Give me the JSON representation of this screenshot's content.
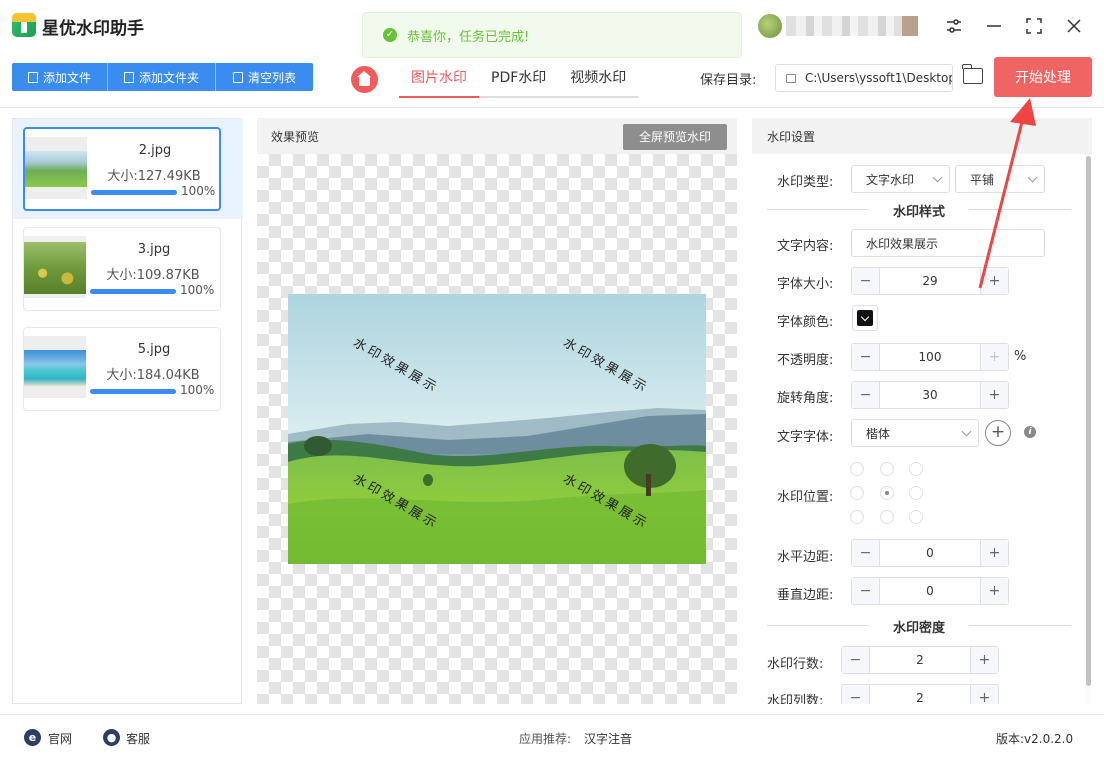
{
  "app": {
    "title": "星优水印助手"
  },
  "toast": {
    "message": "恭喜你，任务已完成!"
  },
  "toolbar": {
    "add_file": "添加文件",
    "add_folder": "添加文件夹",
    "clear_list": "清空列表",
    "tabs": [
      "图片水印",
      "PDF水印",
      "视频水印"
    ],
    "active_tab": "图片水印",
    "save_label": "保存目录:",
    "save_path": "C:\\Users\\yssoft1\\Desktop",
    "start": "开始处理"
  },
  "files": [
    {
      "name": "2.jpg",
      "size": "大小:127.49KB",
      "progress_pct": "100%",
      "progress": 1.0,
      "selected": true
    },
    {
      "name": "3.jpg",
      "size": "大小:109.87KB",
      "progress_pct": "100%",
      "progress": 1.0,
      "selected": false
    },
    {
      "name": "5.jpg",
      "size": "大小:184.04KB",
      "progress_pct": "100%",
      "progress": 1.0,
      "selected": false
    }
  ],
  "preview": {
    "title": "效果预览",
    "fullscreen": "全屏预览水印",
    "watermark_text": "水印效果展示"
  },
  "settings": {
    "title": "水印设置",
    "type_label": "水印类型:",
    "type_value": "文字水印",
    "tile_value": "平铺",
    "style_section": "水印样式",
    "text_label": "文字内容:",
    "text_value": "水印效果展示",
    "fontsize_label": "字体大小:",
    "fontsize_value": "29",
    "color_label": "字体颜色:",
    "opacity_label": "不透明度:",
    "opacity_value": "100",
    "opacity_unit": "%",
    "rotation_label": "旋转角度:",
    "rotation_value": "30",
    "font_label": "文字字体:",
    "font_value": "楷体",
    "position_label": "水印位置:",
    "hmargin_label": "水平边距:",
    "hmargin_value": "0",
    "vmargin_label": "垂直边距:",
    "vmargin_value": "0",
    "density_section": "水印密度",
    "rows_label": "水印行数:",
    "rows_value": "2",
    "cols_label": "水印列数:",
    "cols_value": "2"
  },
  "footer": {
    "website": "官网",
    "service": "客服",
    "recommend_label": "应用推荐:",
    "recommend_app": "汉字注音",
    "version": "版本:v2.0.2.0"
  },
  "colors": {
    "primary": "#3b8cf0",
    "accent": "#f05b5b",
    "success": "#67c23a"
  }
}
